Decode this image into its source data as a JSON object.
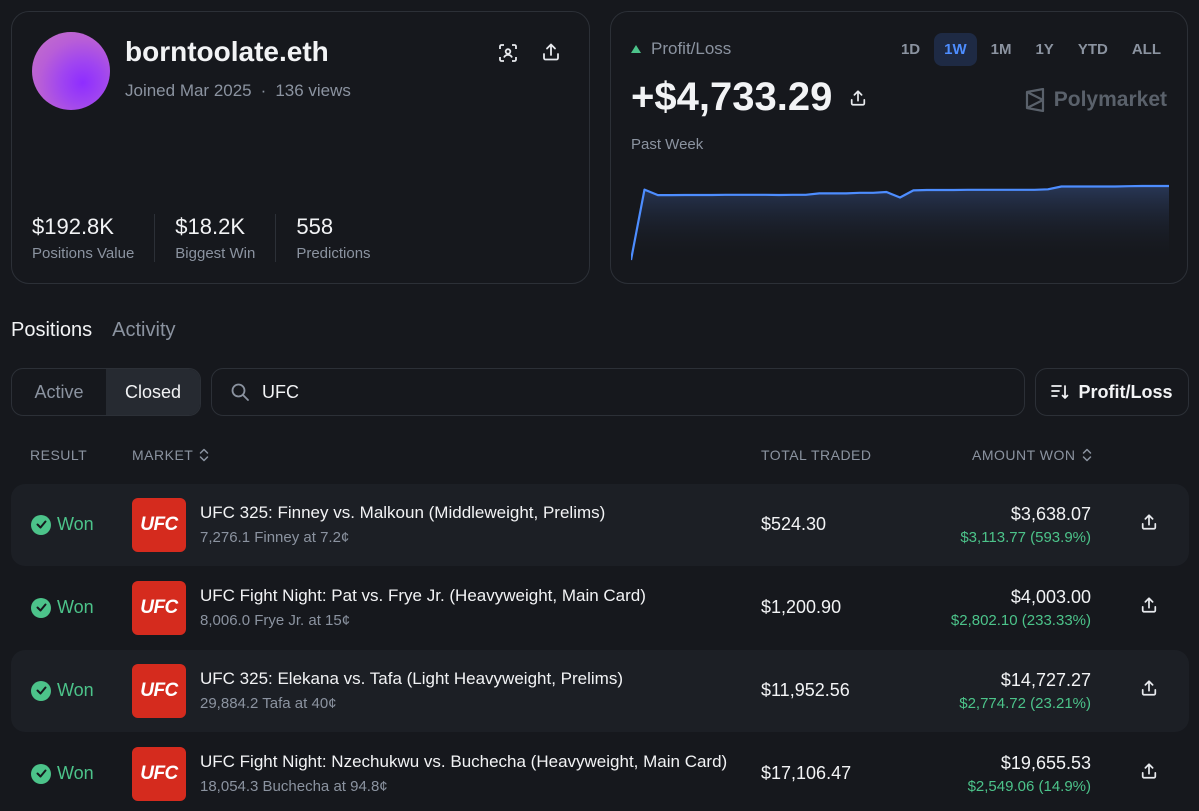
{
  "profile": {
    "username": "borntoolate.eth",
    "joined": "Joined Mar 2025",
    "separator": "·",
    "views": "136 views",
    "stats": [
      {
        "value": "$192.8K",
        "label": "Positions Value"
      },
      {
        "value": "$18.2K",
        "label": "Biggest Win"
      },
      {
        "value": "558",
        "label": "Predictions"
      }
    ]
  },
  "pnl": {
    "label": "Profit/Loss",
    "value": "+$4,733.29",
    "period": "Past Week",
    "brand": "Polymarket",
    "ranges": [
      "1D",
      "1W",
      "1M",
      "1Y",
      "YTD",
      "ALL"
    ],
    "active_range": "1W",
    "line_color": "#4d8dff"
  },
  "chart_data": {
    "type": "area",
    "title": "",
    "x": [
      0,
      1,
      2,
      3,
      4,
      5,
      6,
      7,
      8,
      9,
      10,
      11,
      12,
      13,
      14,
      15,
      16,
      17,
      18,
      19,
      20,
      21,
      22,
      23,
      24,
      25,
      26,
      27,
      28,
      29,
      30,
      31,
      32,
      33,
      34,
      35,
      36,
      37,
      38,
      39,
      40
    ],
    "values": [
      0,
      4500,
      4150,
      4150,
      4160,
      4160,
      4160,
      4170,
      4170,
      4170,
      4170,
      4160,
      4170,
      4170,
      4260,
      4260,
      4260,
      4300,
      4300,
      4350,
      4000,
      4450,
      4480,
      4480,
      4480,
      4490,
      4490,
      4490,
      4490,
      4490,
      4490,
      4520,
      4700,
      4700,
      4700,
      4700,
      4700,
      4720,
      4730,
      4733,
      4733
    ],
    "grid": false,
    "legend": "none"
  },
  "tabs": {
    "positions": "Positions",
    "activity": "Activity"
  },
  "filter": {
    "active": "Active",
    "closed": "Closed"
  },
  "search": {
    "value": "UFC"
  },
  "sort": {
    "label": "Profit/Loss"
  },
  "table": {
    "headers": {
      "result": "RESULT",
      "market": "MARKET",
      "traded": "TOTAL TRADED",
      "won": "AMOUNT WON"
    },
    "rows": [
      {
        "result": "Won",
        "logo": "UFC",
        "title": "UFC 325: Finney vs. Malkoun (Middleweight, Prelims)",
        "sub": "7,276.1 Finney at 7.2¢",
        "traded": "$524.30",
        "amount": "$3,638.07",
        "gain": "$3,113.77 (593.9%)"
      },
      {
        "result": "Won",
        "logo": "UFC",
        "title": "UFC Fight Night: Pat vs. Frye Jr. (Heavyweight, Main Card)",
        "sub": "8,006.0 Frye Jr. at 15¢",
        "traded": "$1,200.90",
        "amount": "$4,003.00",
        "gain": "$2,802.10 (233.33%)"
      },
      {
        "result": "Won",
        "logo": "UFC",
        "title": "UFC 325: Elekana vs. Tafa (Light Heavyweight, Prelims)",
        "sub": "29,884.2 Tafa at 40¢",
        "traded": "$11,952.56",
        "amount": "$14,727.27",
        "gain": "$2,774.72 (23.21%)"
      },
      {
        "result": "Won",
        "logo": "UFC",
        "title": "UFC Fight Night: Nzechukwu vs. Buchecha (Heavyweight, Main Card)",
        "sub": "18,054.3 Buchecha at 94.8¢",
        "traded": "$17,106.47",
        "amount": "$19,655.53",
        "gain": "$2,549.06 (14.9%)"
      }
    ]
  }
}
